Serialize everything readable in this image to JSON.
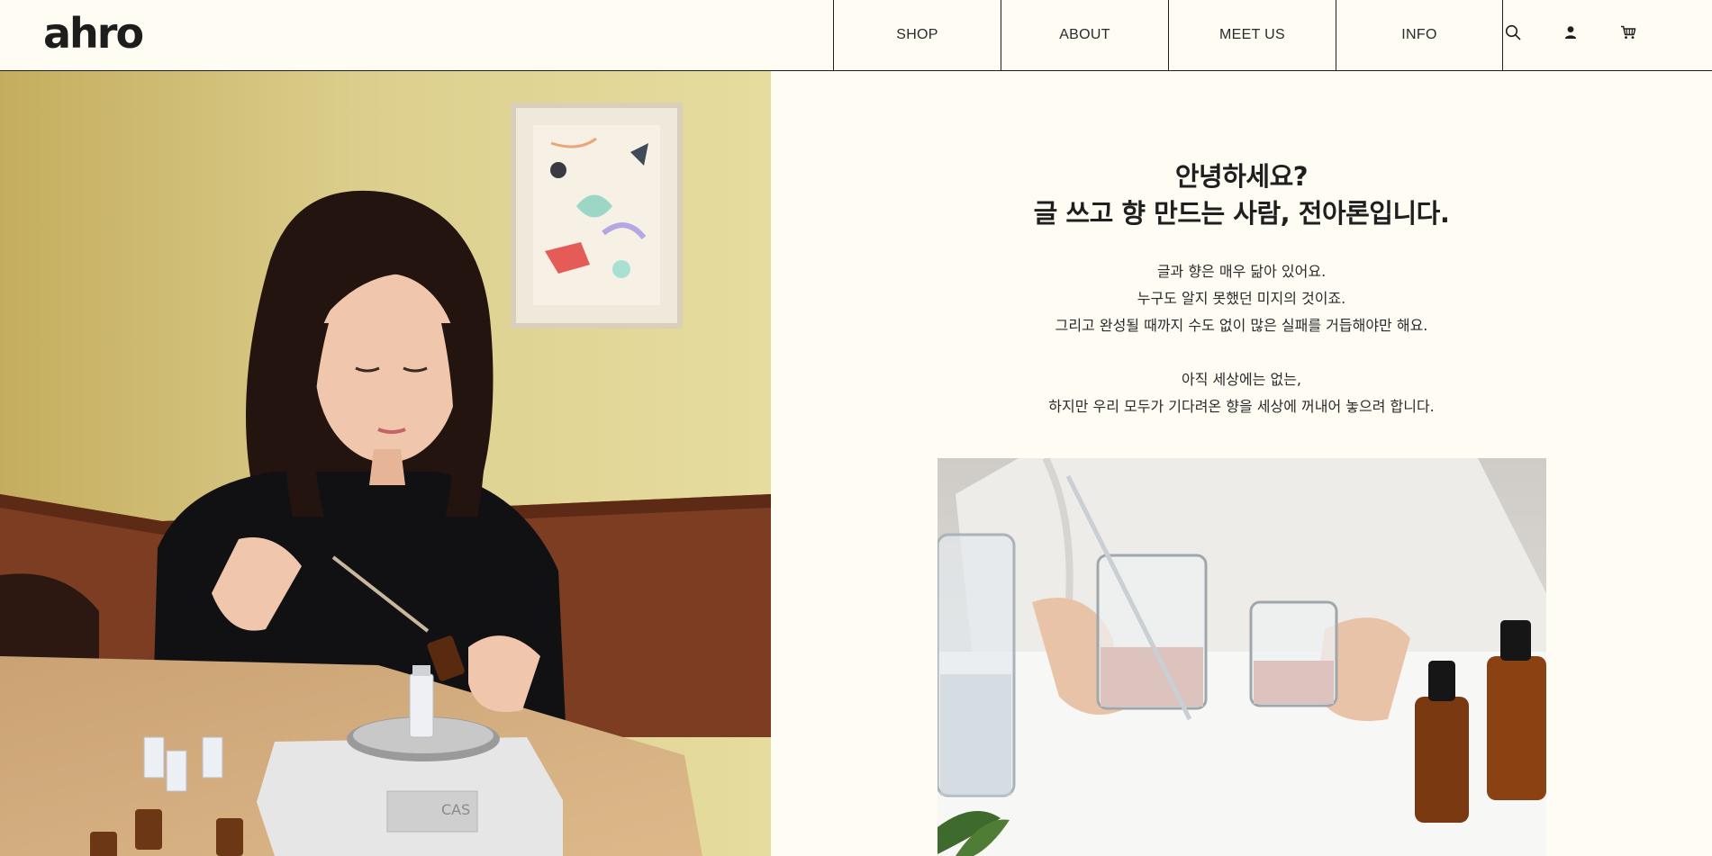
{
  "brand": {
    "logo_text": "ahro"
  },
  "nav": {
    "items": [
      "SHOP",
      "ABOUT",
      "MEET US",
      "INFO"
    ]
  },
  "icons": [
    "search-icon",
    "user-icon",
    "cart-icon"
  ],
  "intro": {
    "headline_1": "안녕하세요?",
    "headline_2": "글 쓰고 향 만드는 사람, 전아론입니다.",
    "para1": [
      "글과 향은 매우 닮아 있어요.",
      "누구도 알지 못했던 미지의 것이죠.",
      "그리고 완성될 때까지 수도 없이 많은 실패를 거듭해야만 해요."
    ],
    "para2": [
      "아직 세상에는 없는,",
      "하지만 우리 모두가 기다려온 향을 세상에 꺼내어 놓으려 합니다."
    ]
  },
  "colors": {
    "background": "#fffcf4",
    "line": "#1f1f1f",
    "text": "#222222"
  }
}
